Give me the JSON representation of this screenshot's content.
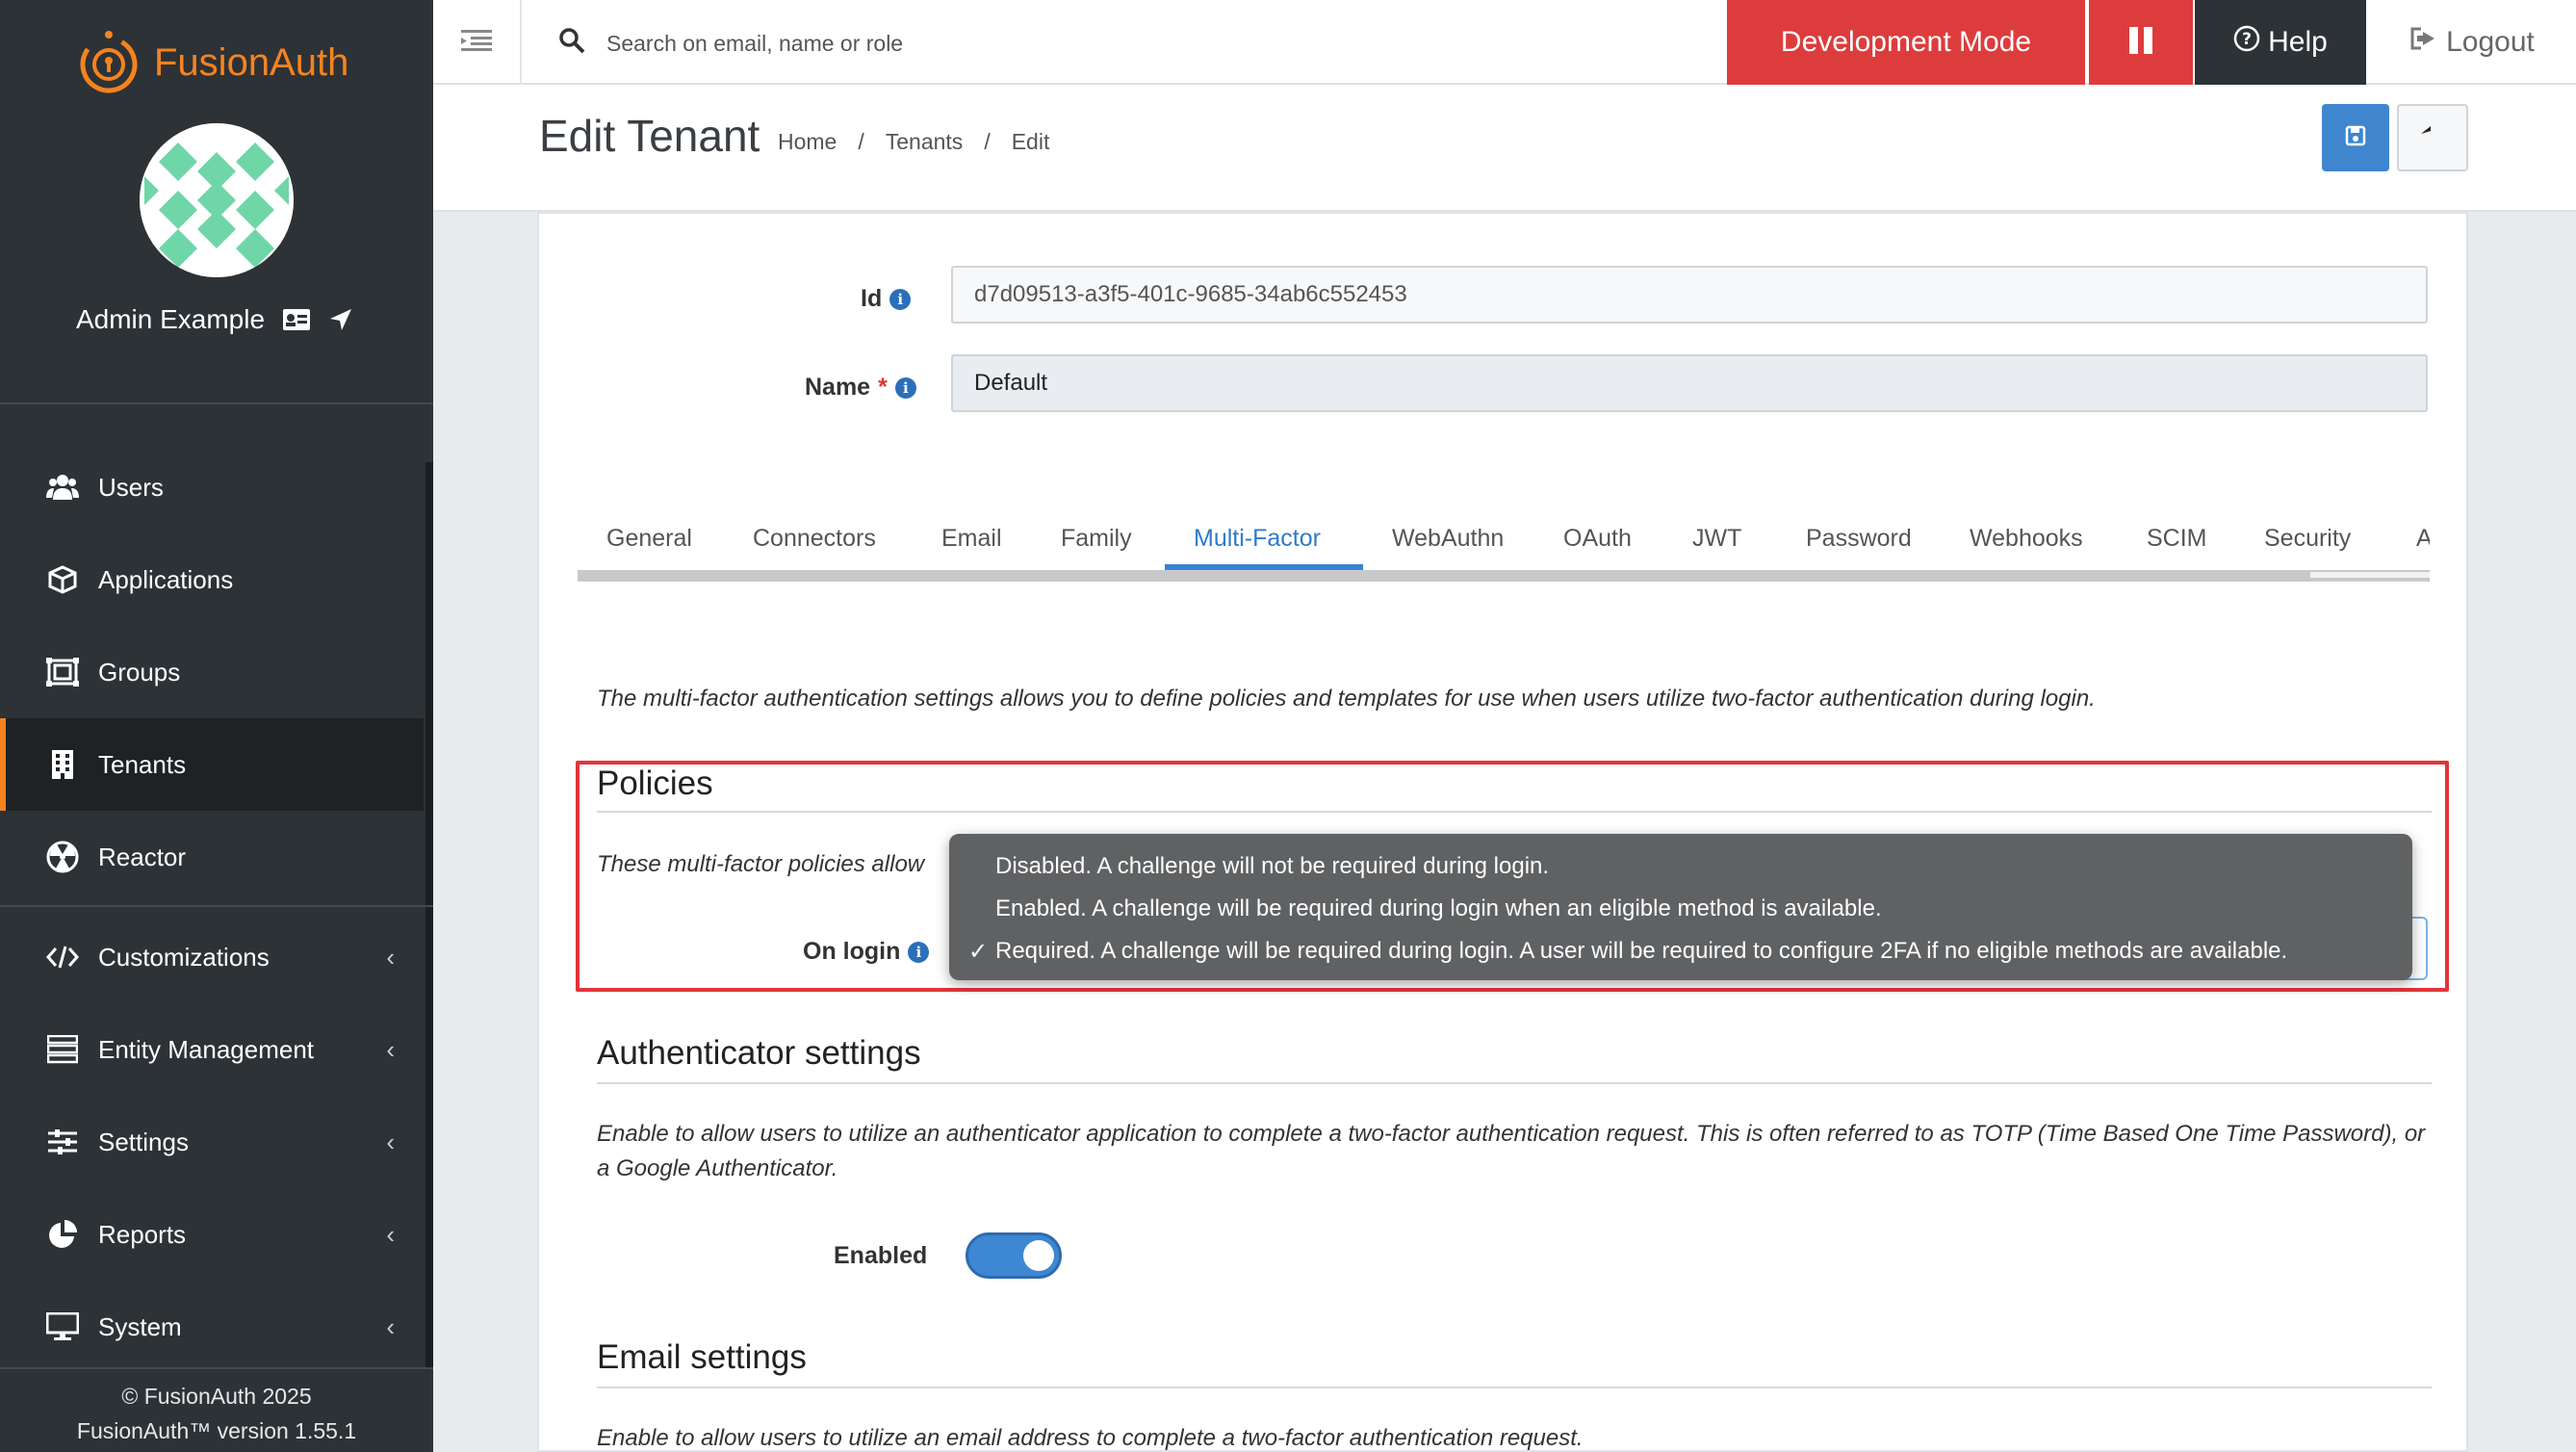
{
  "brand": {
    "name": "FusionAuth",
    "accent": "#f58320"
  },
  "user": {
    "name": "Admin Example"
  },
  "nav": {
    "items": [
      {
        "label": "Users",
        "icon": "users-icon"
      },
      {
        "label": "Applications",
        "icon": "cube-icon"
      },
      {
        "label": "Groups",
        "icon": "groups-icon"
      },
      {
        "label": "Tenants",
        "icon": "building-icon",
        "active": true
      },
      {
        "label": "Reactor",
        "icon": "reactor-icon"
      },
      {
        "label": "Customizations",
        "icon": "code-icon",
        "has_submenu": true
      },
      {
        "label": "Entity Management",
        "icon": "server-icon",
        "has_submenu": true
      },
      {
        "label": "Settings",
        "icon": "sliders-icon",
        "has_submenu": true
      },
      {
        "label": "Reports",
        "icon": "pie-chart-icon",
        "has_submenu": true
      },
      {
        "label": "System",
        "icon": "monitor-icon",
        "has_submenu": true
      }
    ]
  },
  "footer": {
    "copyright": "© FusionAuth 2025",
    "version": "FusionAuth™ version 1.55.1"
  },
  "topbar": {
    "search_placeholder": "Search on email, name or role",
    "dev_mode": "Development Mode",
    "help": "Help",
    "logout": "Logout",
    "dev_color": "#dd3c3c"
  },
  "header": {
    "title": "Edit Tenant",
    "breadcrumbs": [
      "Home",
      "/",
      "Tenants",
      "/",
      "Edit"
    ]
  },
  "form": {
    "id_label": "Id",
    "id_value": "d7d09513-a3f5-401c-9685-34ab6c552453",
    "name_label": "Name",
    "name_required": "*",
    "name_value": "Default"
  },
  "tabs": [
    "General",
    "Connectors",
    "Email",
    "Family",
    "Multi-Factor",
    "WebAuthn",
    "OAuth",
    "JWT",
    "Password",
    "Webhooks",
    "SCIM",
    "Security",
    "A"
  ],
  "active_tab": "Multi-Factor",
  "mfa": {
    "intro": "The multi-factor authentication settings allows you to define policies and templates for use when users utilize two-factor authentication during login.",
    "policies": {
      "title": "Policies",
      "desc": "These multi-factor policies allow",
      "on_login_label": "On login",
      "options": [
        "Disabled. A challenge will not be required during login.",
        "Enabled. A challenge will be required during login when an eligible method is available.",
        "Required. A challenge will be required during login. A user will be required to configure 2FA if no eligible methods are available."
      ],
      "selected_index": 2,
      "check_mark": "✓"
    },
    "authenticator": {
      "title": "Authenticator settings",
      "desc": "Enable to allow users to utilize an authenticator application to complete a two-factor authentication request. This is often referred to as TOTP (Time Based One Time Password), or a Google Authenticator.",
      "enabled_label": "Enabled",
      "enabled": true
    },
    "email": {
      "title": "Email settings",
      "desc": "Enable to allow users to utilize an email address to complete a two-factor authentication request."
    }
  }
}
